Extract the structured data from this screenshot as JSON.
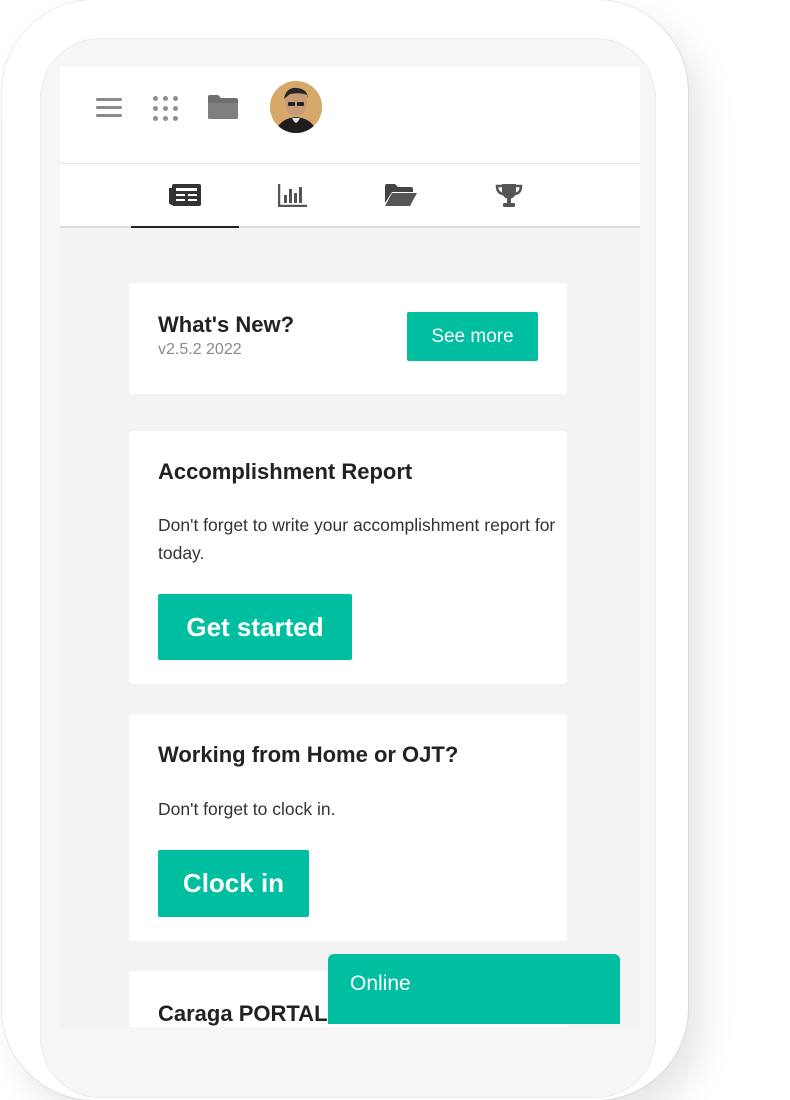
{
  "brand": {
    "accent": "#00bfa0",
    "background": "#f3f3f3",
    "text": "#222222"
  },
  "topbar": {
    "icons": [
      "menu-icon",
      "apps-icon",
      "folder-icon",
      "avatar"
    ]
  },
  "tabs": [
    {
      "icon": "newspaper-icon",
      "active": true
    },
    {
      "icon": "bar-chart-icon",
      "active": false
    },
    {
      "icon": "folder-open-icon",
      "active": false
    },
    {
      "icon": "trophy-icon",
      "active": false
    }
  ],
  "whats_new": {
    "title": "What's New?",
    "version": "v2.5.2 2022",
    "button": "See more"
  },
  "accomplishment": {
    "title": "Accomplishment Report",
    "description": "Don't forget to write your accomplishment report for today.",
    "button": "Get started"
  },
  "wfh": {
    "title": "Working from Home or OJT?",
    "description": "Don't forget to clock in.",
    "button": "Clock in"
  },
  "portal": {
    "title": "Caraga PORTAL"
  },
  "status": {
    "label": "Online"
  }
}
